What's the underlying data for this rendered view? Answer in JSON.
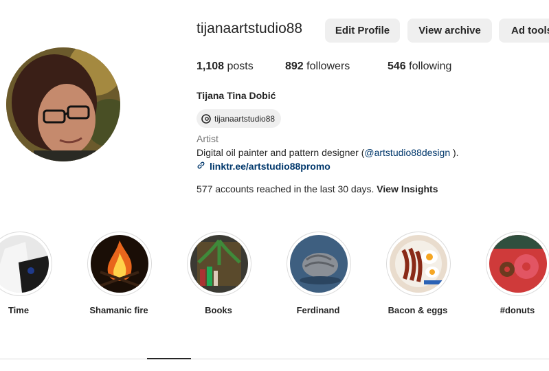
{
  "profile": {
    "username": "tijanaartstudio88",
    "buttons": {
      "edit_profile": "Edit Profile",
      "view_archive": "View archive",
      "ad_tools": "Ad tools"
    },
    "stats": {
      "posts_count": "1,108",
      "posts_label": " posts",
      "followers_count": "892",
      "followers_label": " followers",
      "following_count": "546",
      "following_label": " following"
    },
    "full_name": "Tijana Tina Dobić",
    "threads_handle": "tijanaartstudio88",
    "category": "Artist",
    "bio_text": "Digital oil painter and pattern designer (",
    "bio_mention": "@artstudio88design",
    "bio_suffix": " ).",
    "link": "linktr.ee/artstudio88promo",
    "insights_text": "577 accounts reached in the last 30 days. ",
    "insights_link": "View Insights"
  },
  "highlights": [
    {
      "label": "Time"
    },
    {
      "label": "Shamanic fire"
    },
    {
      "label": "Books"
    },
    {
      "label": "Ferdinand"
    },
    {
      "label": "Bacon & eggs"
    },
    {
      "label": "#donuts"
    }
  ],
  "colors": {
    "link": "#00376b",
    "button_bg": "#efefef",
    "muted": "#737373"
  }
}
